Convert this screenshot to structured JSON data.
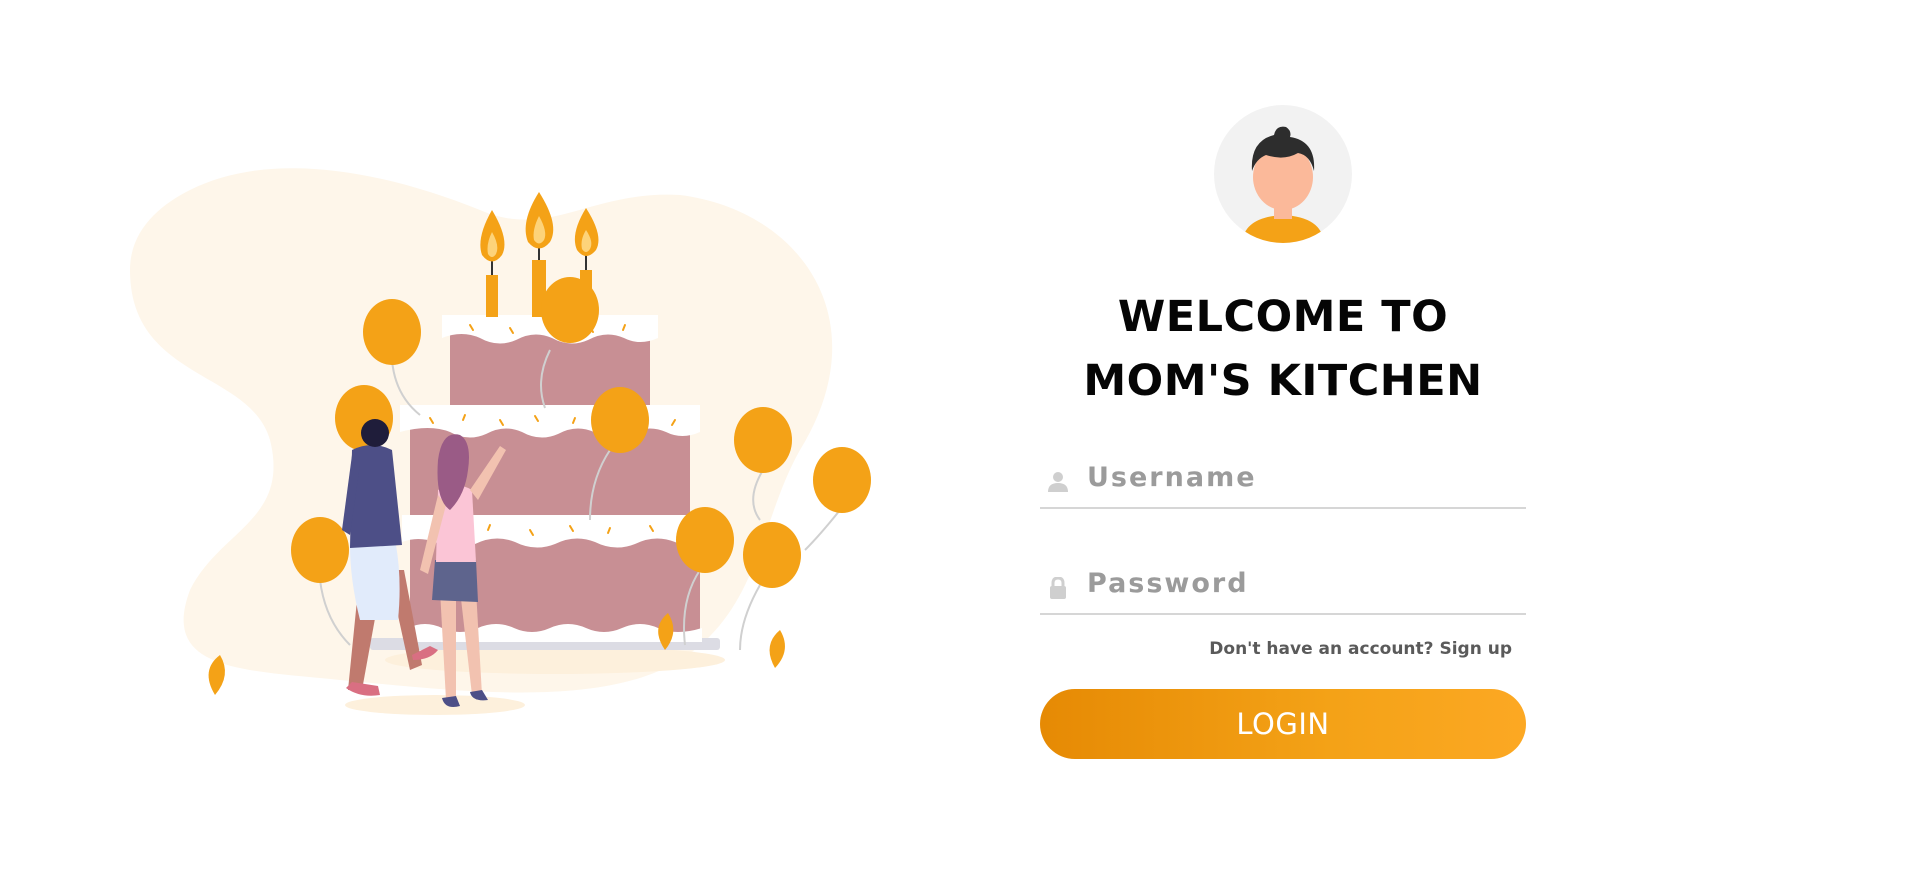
{
  "illustration": {
    "icon": "birthday-cake-illustration"
  },
  "avatar": {
    "icon": "user-avatar-icon"
  },
  "title": "WELCOME TO MOM'S KITCHEN",
  "form": {
    "username": {
      "placeholder": "Username",
      "value": "",
      "icon": "user-icon"
    },
    "password": {
      "placeholder": "Password",
      "value": "",
      "icon": "lock-icon"
    },
    "signup": {
      "prompt": "Don't have an account?",
      "link": "Sign up"
    },
    "login_label": "LOGIN"
  },
  "colors": {
    "accent": "#f4a217",
    "accent_dark": "#e68a04",
    "blob": "#fef6ea",
    "cake": "#c88f94",
    "icing": "#ffffff"
  }
}
